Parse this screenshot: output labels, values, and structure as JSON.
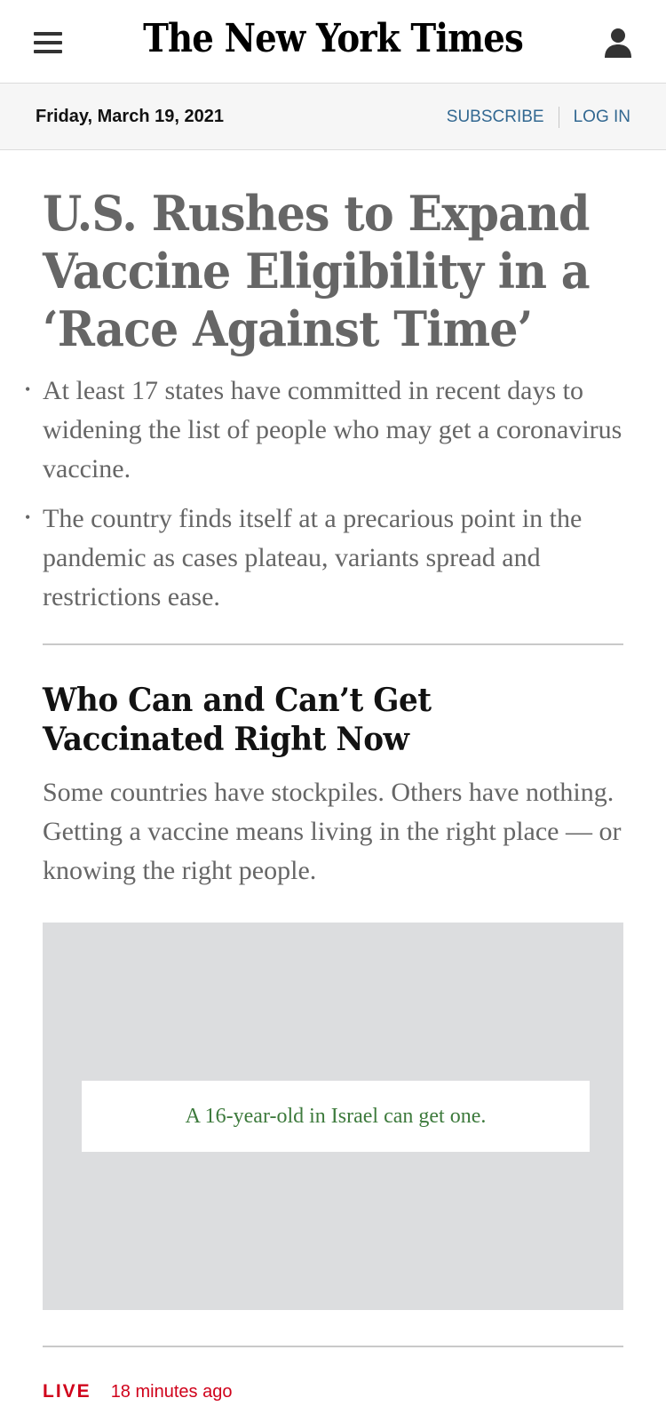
{
  "header": {
    "masthead": "The New York Times",
    "menu_icon": "hamburger-menu-icon",
    "account_icon": "person-icon"
  },
  "datebar": {
    "date": "Friday, March 19, 2021",
    "subscribe": "SUBSCRIBE",
    "login": "LOG IN"
  },
  "lead_story": {
    "headline": "U.S. Rushes to Expand Vaccine Eligibility in a ‘Race Against Time’",
    "bullets": [
      "At least 17 states have committed in recent days to widening the list of people who may get a coronavirus vaccine.",
      "The country finds itself at a precarious point in the pandemic as cases plateau, variants spread and restrictions ease."
    ]
  },
  "second_story": {
    "headline": "Who Can and Can’t Get Vaccinated Right Now",
    "summary": "Some countries have stockpiles. Others have nothing. Getting a vaccine means living in the right place — or knowing the right people.",
    "media_caption": "A 16-year-old in Israel can get one."
  },
  "live_item": {
    "label": "LIVE",
    "timestamp": "18 minutes ago"
  },
  "colors": {
    "link_blue": "#326891",
    "live_red": "#d0021b",
    "caption_green": "#3d7a3c",
    "media_gray": "#dcdddf"
  }
}
